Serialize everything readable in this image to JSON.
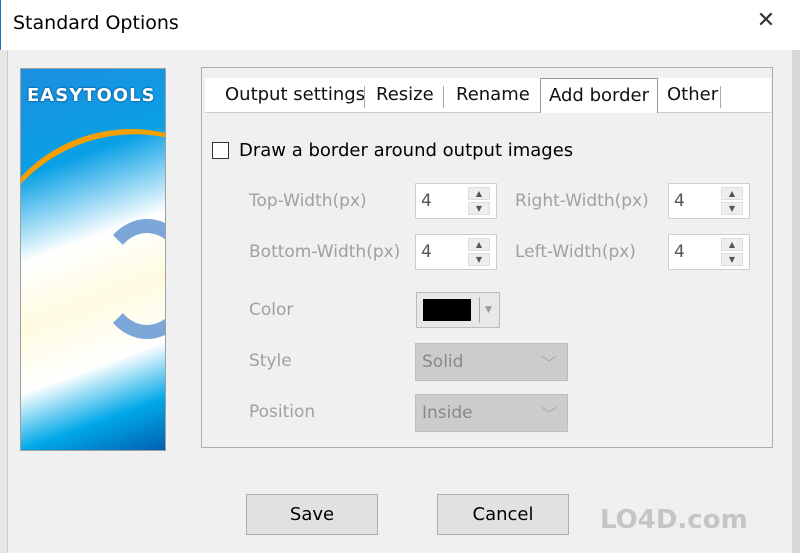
{
  "window": {
    "title": "Standard Options",
    "close": "✕"
  },
  "banner": {
    "logo_text": "EASYTOOLS"
  },
  "tabs": [
    {
      "label": "Output settings"
    },
    {
      "label": "Resize"
    },
    {
      "label": "Rename"
    },
    {
      "label": "Add border",
      "selected": true
    },
    {
      "label": "Other"
    }
  ],
  "border": {
    "checkbox_label": "Draw a border around output images",
    "checked": false,
    "top_label": "Top-Width(px)",
    "top_value": "4",
    "right_label": "Right-Width(px)",
    "right_value": "4",
    "bottom_label": "Bottom-Width(px)",
    "bottom_value": "4",
    "left_label": "Left-Width(px)",
    "left_value": "4",
    "color_label": "Color",
    "color_value": "#000000",
    "style_label": "Style",
    "style_value": "Solid",
    "position_label": "Position",
    "position_value": "Inside"
  },
  "buttons": {
    "save": "Save",
    "cancel": "Cancel"
  },
  "watermark": "LO4D.com"
}
